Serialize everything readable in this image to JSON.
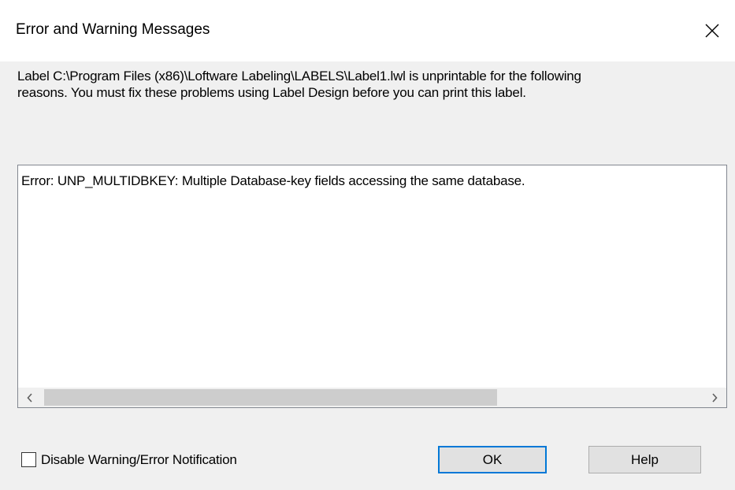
{
  "window": {
    "title": "Error and Warning Messages"
  },
  "message": {
    "line1": "Label C:\\Program Files (x86)\\Loftware Labeling\\LABELS\\Label1.lwl is unprintable for the following",
    "line2": "reasons.  You must fix these problems using Label Design before you can print this label."
  },
  "errors": {
    "items": [
      "Error: UNP_MULTIDBKEY: Multiple Database-key fields accessing the same database."
    ],
    "scroll_position": 0,
    "visible_fraction": 0.69
  },
  "options": {
    "disable_notification_label": "Disable Warning/Error Notification",
    "disable_notification_checked": false
  },
  "buttons": {
    "ok_label": "OK",
    "help_label": "Help"
  },
  "icons": {
    "close": "close-icon",
    "scroll_left": "chevron-left-icon",
    "scroll_right": "chevron-right-icon"
  },
  "colors": {
    "accent": "#0078d7",
    "dialog_background": "#f0f0f0",
    "titlebar_background": "#ffffff"
  }
}
